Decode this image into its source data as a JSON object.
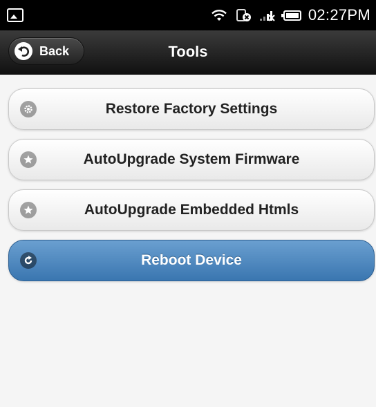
{
  "status_bar": {
    "time": "02:27PM",
    "icons": [
      "gallery-icon",
      "wifi-icon",
      "alarm-off-icon",
      "signal-icon",
      "battery-icon"
    ]
  },
  "header": {
    "back_label": "Back",
    "title": "Tools"
  },
  "menu": {
    "items": [
      {
        "label": "Restore Factory Settings",
        "icon": "gear-icon",
        "active": false
      },
      {
        "label": "AutoUpgrade System Firmware",
        "icon": "star-icon",
        "active": false
      },
      {
        "label": "AutoUpgrade Embedded Htmls",
        "icon": "star-icon",
        "active": false
      },
      {
        "label": "Reboot Device",
        "icon": "refresh-icon",
        "active": true
      }
    ]
  },
  "colors": {
    "active_button": "#3a76b0",
    "header_bg": "#1a1a1a",
    "page_bg": "#f5f5f5"
  }
}
